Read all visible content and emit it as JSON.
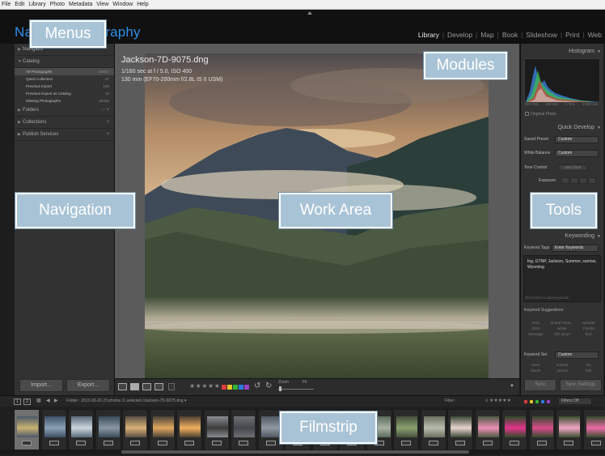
{
  "menu": {
    "items": [
      "File",
      "Edit",
      "Library",
      "Photo",
      "Metadata",
      "View",
      "Window",
      "Help"
    ]
  },
  "identity_plate": {
    "text": "Nature Photography",
    "color": "#2f8ee6"
  },
  "modules": {
    "items": [
      "Library",
      "Develop",
      "Map",
      "Book",
      "Slideshow",
      "Print",
      "Web"
    ],
    "active": "Library",
    "separator": "|"
  },
  "left_panel": {
    "navigator_header": "Navigator",
    "catalog": {
      "header": "Catalog",
      "items": [
        {
          "label": "All Photographs",
          "count": "46817"
        },
        {
          "label": "Quick Collection",
          "count": "27"
        },
        {
          "label": "Previous Import",
          "count": "100"
        },
        {
          "label": "Previous Export as Catalog",
          "count": "12"
        },
        {
          "label": "Missing Photographs",
          "count": "34442"
        }
      ]
    },
    "folders_header": "Folders",
    "collections_header": "Collections",
    "publish_header": "Publish Services",
    "import_label": "Import...",
    "export_label": "Export..."
  },
  "photo_info": {
    "title": "Jackson-7D-9075.dng",
    "line2": "1/160 sec at f / 5.0, ISO 400",
    "line3": "130 mm (EF70-200mm f/2.8L IS II USM)"
  },
  "toolbar": {
    "stars": "★★★★★",
    "zoom_label": "Zoom",
    "fit_label": "Fit",
    "flag_colors": [
      "#e23b3b",
      "#e5c52a",
      "#35b43a",
      "#2f7de0",
      "#9a43c9"
    ]
  },
  "right_panel": {
    "histogram_header": "Histogram",
    "histogram_meta": [
      "ISO 400",
      "130 mm",
      "f / 5.0",
      "1/160 sec"
    ],
    "original_photo_label": "Original Photo",
    "quick_develop_header": "Quick Develop",
    "saved_preset_label": "Saved Preset",
    "saved_preset_value": "Custom",
    "white_balance_label": "White Balance",
    "white_balance_value": "Custom",
    "tone_control_label": "Tone Control",
    "auto_tone_label": "Auto Tone",
    "exposure_label": "Exposure",
    "keywording_header": "Keywording",
    "keyword_tags_label": "Keyword Tags",
    "keyword_tags_value": "Enter Keywords",
    "keywords_text": "fog, GTNP, Jackson, Summer, sunrise, Wyoming",
    "keywords_add_hint": "Click here to add keywords",
    "suggestions_header": "Keyword Suggestions",
    "suggestions": [
      "2011",
      "Grand Teton...",
      "summer",
      "2012",
      "winter",
      "Florida",
      "message",
      "fish tacos",
      "bird"
    ],
    "keyword_set_label": "Keyword Set",
    "keyword_set_value": "Custom",
    "keyword_set_items": [
      "trees",
      "outside",
      "sky",
      "bloom",
      "animal",
      "fruit"
    ],
    "sync_label": "Sync",
    "sync_settings_label": "Sync Settings"
  },
  "filmstrip_bar": {
    "page1": "1",
    "page2": "2",
    "info_text": "Folder : 2013-06-26    23 photos /1 selected /Jackson-7D-9075.dng ▾",
    "filter_label": "Filter :",
    "stars": "≥ ★★★★★",
    "filters_off": "Filters Off",
    "dot_colors": [
      "#e23b3b",
      "#e5c52a",
      "#35b43a",
      "#2f7de0",
      "#9a43c9"
    ]
  },
  "filmstrip": {
    "thumbs": [
      {
        "c1": "#4a5868",
        "c2": "#c9b070"
      },
      {
        "c1": "#3d5066",
        "c2": "#8aa0b4"
      },
      {
        "c1": "#5a6a78",
        "c2": "#cdd6de"
      },
      {
        "c1": "#3a4a58",
        "c2": "#8a98a4"
      },
      {
        "c1": "#5a4f44",
        "c2": "#d9b278"
      },
      {
        "c1": "#4a4238",
        "c2": "#e0a860"
      },
      {
        "c1": "#4e4030",
        "c2": "#f0b060"
      },
      {
        "c1": "#888c90",
        "c2": "#3c3c3c"
      },
      {
        "c1": "#6e7074",
        "c2": "#44484c"
      },
      {
        "c1": "#505862",
        "c2": "#8f98a0"
      },
      {
        "c1": "#414b55",
        "c2": "#6e7a84"
      },
      {
        "c1": "#3c4a3c",
        "c2": "#6a7a5a"
      },
      {
        "c1": "#3a3f44",
        "c2": "#7a8288"
      },
      {
        "c1": "#5a6a5a",
        "c2": "#a8b2a4"
      },
      {
        "c1": "#45503c",
        "c2": "#8aa070"
      },
      {
        "c1": "#6a7060",
        "c2": "#b8bcae"
      },
      {
        "c1": "#3c4838",
        "c2": "#e8d4d0"
      },
      {
        "c1": "#4a5a40",
        "c2": "#ee8fb8"
      },
      {
        "c1": "#2f4a2a",
        "c2": "#e2348c"
      },
      {
        "c1": "#324a2c",
        "c2": "#d84c8c"
      },
      {
        "c1": "#3a5030",
        "c2": "#f2a4c4"
      },
      {
        "c1": "#364c2e",
        "c2": "#ea6aa4"
      },
      {
        "c1": "#3a4e30",
        "c2": "#f090bc"
      }
    ]
  },
  "callouts": {
    "menus": "Menus",
    "modules": "Modules",
    "navigation": "Navigation",
    "work_area": "Work Area",
    "tools": "Tools",
    "filmstrip": "Filmstrip"
  },
  "colors": {
    "callout_fill": "#a9c3d6",
    "callout_text": "#ffffff",
    "panel": "#323232",
    "accent": "#2f8ee6"
  }
}
